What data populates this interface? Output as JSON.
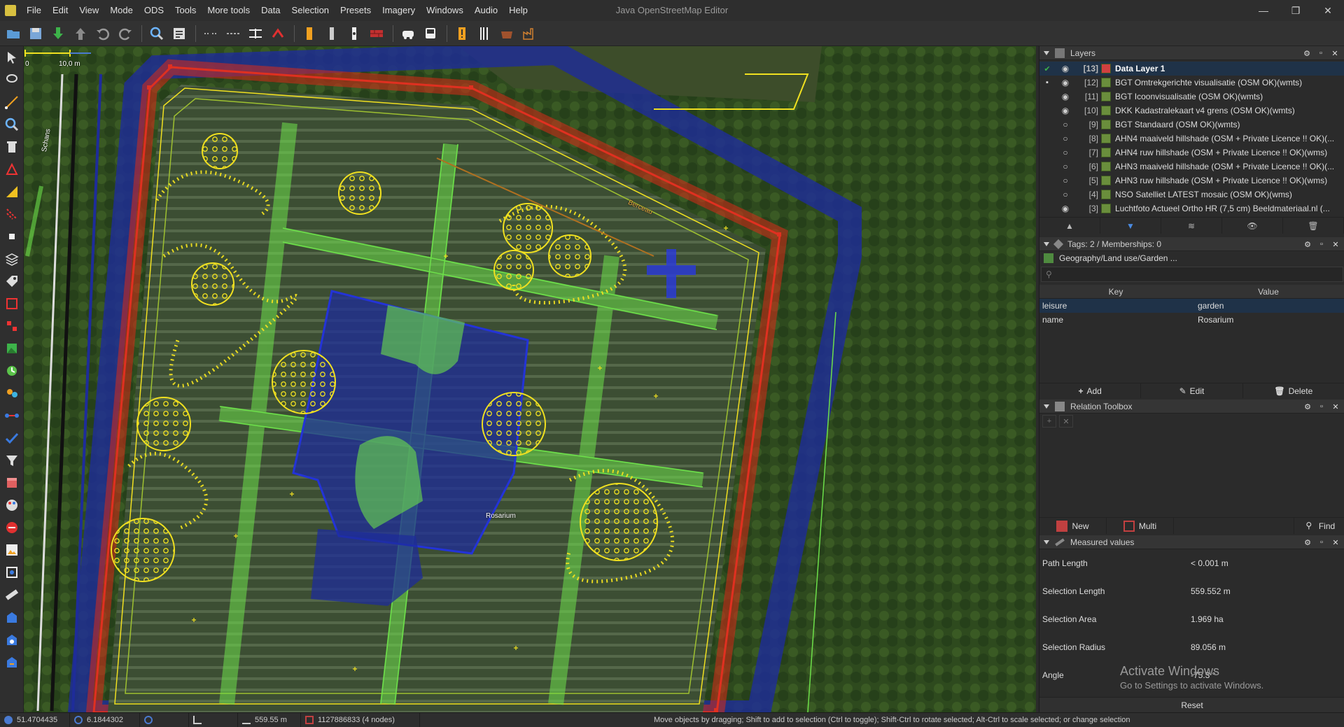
{
  "window": {
    "title": "Java OpenStreetMap Editor",
    "controls": {
      "minimize": "—",
      "maximize": "❐",
      "close": "✕"
    }
  },
  "menu": [
    "File",
    "Edit",
    "View",
    "Mode",
    "ODS",
    "Tools",
    "More tools",
    "Data",
    "Selection",
    "Presets",
    "Imagery",
    "Windows",
    "Audio",
    "Help"
  ],
  "toolbar": {
    "icons": [
      "open-icon",
      "save-icon",
      "download-icon",
      "upload-icon",
      "undo-icon",
      "redo-icon",
      "zoom-icon",
      "preferences-icon",
      "split-way-icon",
      "combine-way-icon",
      "align-icon",
      "reverse-icon",
      "preset-barrier-icon",
      "preset-door-icon",
      "preset-light-icon",
      "preset-wall-icon",
      "preset-car-icon",
      "preset-bus-icon",
      "preset-hazard-icon",
      "preset-restaurant-icon",
      "preset-shop-icon",
      "preset-factory-icon"
    ]
  },
  "map": {
    "scale": {
      "zero": "0",
      "length": "10,0 m"
    },
    "labels": {
      "road": "Schans",
      "building": "Berceau",
      "garden": "Rosarium"
    },
    "colors": {
      "selection_red": "#d82a18",
      "water_blue": "#1e2c9a",
      "node_yellow": "#f0e020",
      "garden_green": "#6de04a"
    }
  },
  "layers": {
    "title": "Layers",
    "items": [
      {
        "index": "[13]",
        "name": "Data Layer 1",
        "active": true,
        "check": "✔",
        "vis": "◉"
      },
      {
        "index": "[12]",
        "name": "BGT Omtrekgerichte visualisatie  (OSM OK)(wmts)",
        "active": false,
        "check": "▪",
        "vis": "◉"
      },
      {
        "index": "[11]",
        "name": "BGT Icoonvisualisatie (OSM OK)(wmts)",
        "active": false,
        "check": "",
        "vis": "◉"
      },
      {
        "index": "[10]",
        "name": "DKK Kadastralekaart v4 grens (OSM OK)(wmts)",
        "active": false,
        "check": "",
        "vis": "◉"
      },
      {
        "index": "[9]",
        "name": "BGT Standaard (OSM OK)(wmts)",
        "active": false,
        "check": "",
        "vis": "○"
      },
      {
        "index": "[8]",
        "name": "AHN4 maaiveld hillshade (OSM + Private Licence !! OK)(...",
        "active": false,
        "check": "",
        "vis": "○"
      },
      {
        "index": "[7]",
        "name": "AHN4 ruw hillshade (OSM +  Private Licence !! OK)(wms)",
        "active": false,
        "check": "",
        "vis": "○"
      },
      {
        "index": "[6]",
        "name": "AHN3 maaiveld hillshade (OSM + Private Licence !! OK)(...",
        "active": false,
        "check": "",
        "vis": "○"
      },
      {
        "index": "[5]",
        "name": "AHN3 ruw hillshade (OSM +  Private Licence !! OK)(wms)",
        "active": false,
        "check": "",
        "vis": "○"
      },
      {
        "index": "[4]",
        "name": "NSO Satelliet LATEST mosaic (OSM OK)(wms)",
        "active": false,
        "check": "",
        "vis": "○"
      },
      {
        "index": "[3]",
        "name": "Luchtfoto Actueel Ortho HR (7,5 cm) Beeldmateriaal.nl (...",
        "active": false,
        "check": "",
        "vis": "◉"
      }
    ],
    "actions": [
      "▲",
      "▼",
      "≋",
      "👁",
      "🗑"
    ]
  },
  "tags": {
    "title": "Tags: 2 / Memberships: 0",
    "preset": "Geography/Land use/Garden ...",
    "search_placeholder": "",
    "columns": {
      "key": "Key",
      "value": "Value"
    },
    "rows": [
      {
        "key": "leisure",
        "value": "garden"
      },
      {
        "key": "name",
        "value": "Rosarium"
      }
    ],
    "actions": {
      "add": "Add",
      "edit": "Edit",
      "delete": "Delete"
    }
  },
  "relation": {
    "title": "Relation Toolbox",
    "actions": {
      "new": "New",
      "multi": "Multi",
      "find": "Find"
    }
  },
  "measured": {
    "title": "Measured values",
    "rows": [
      {
        "label": "Path Length",
        "value": "< 0.001 m"
      },
      {
        "label": "Selection Length",
        "value": "559.552 m"
      },
      {
        "label": "Selection Area",
        "value": "1.969 ha"
      },
      {
        "label": "Selection Radius",
        "value": "89.056 m"
      },
      {
        "label": "Angle",
        "value": "-75.3 °"
      }
    ],
    "reset": "Reset"
  },
  "overlay": {
    "line1": "Activate Windows",
    "line2": "Go to Settings to activate Windows."
  },
  "status": {
    "lat": "51.4704435",
    "lon": "6.1844302",
    "length": "559.55 m",
    "selection": "1127886833 (4 nodes)",
    "message": "Move objects by dragging; Shift to add to selection (Ctrl to toggle); Shift-Ctrl to rotate selected; Alt-Ctrl to scale selected; or change selection"
  }
}
